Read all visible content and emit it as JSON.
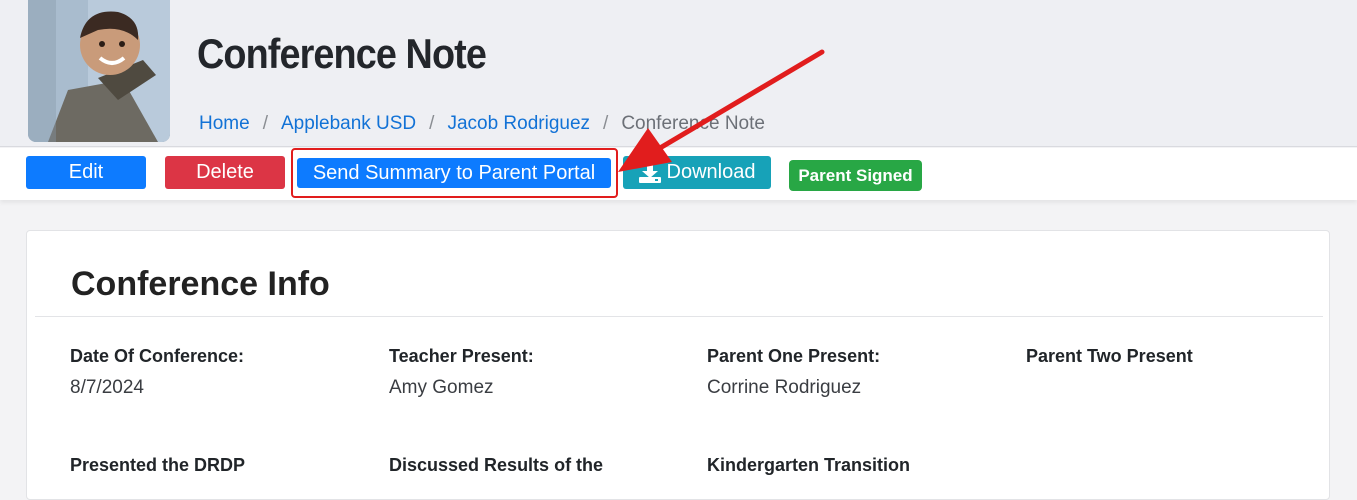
{
  "header": {
    "title": "Conference Note",
    "breadcrumb": [
      {
        "label": "Home"
      },
      {
        "label": "Applebank USD"
      },
      {
        "label": "Jacob Rodriguez"
      },
      {
        "label": "Conference Note"
      }
    ],
    "separator": "/"
  },
  "toolbar": {
    "edit_label": "Edit",
    "delete_label": "Delete",
    "send_label": "Send Summary to Parent Portal",
    "download_label": "Download",
    "download_icon": "download-icon",
    "status_badge": "Parent Signed"
  },
  "card": {
    "title": "Conference Info",
    "fields": [
      {
        "label": "Date Of Conference:",
        "value": "8/7/2024"
      },
      {
        "label": "Teacher Present:",
        "value": "Amy Gomez"
      },
      {
        "label": "Parent One Present:",
        "value": "Corrine Rodriguez"
      },
      {
        "label": "Parent Two Present",
        "value": ""
      },
      {
        "label": "Presented the DRDP",
        "value": ""
      },
      {
        "label": "Discussed Results of the",
        "value": ""
      },
      {
        "label": "Kindergarten Transition",
        "value": ""
      }
    ]
  },
  "colors": {
    "primary": "#0d7bff",
    "danger": "#dc3545",
    "info": "#17a2b8",
    "success": "#28a745",
    "annotation": "#e11d1d"
  }
}
